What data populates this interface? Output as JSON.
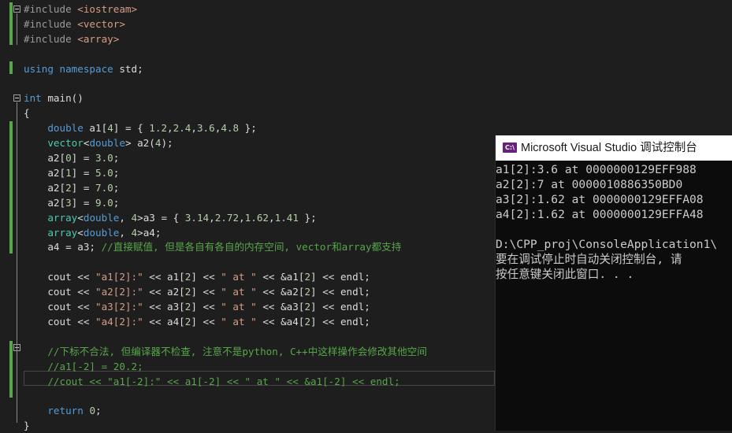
{
  "editor": {
    "lines": [
      [
        [
          "pp",
          "#include "
        ],
        [
          "inc",
          "<iostream>"
        ]
      ],
      [
        [
          "pp",
          "#include "
        ],
        [
          "inc",
          "<vector>"
        ]
      ],
      [
        [
          "pp",
          "#include "
        ],
        [
          "inc",
          "<array>"
        ]
      ],
      [],
      [
        [
          "kw",
          "using namespace"
        ],
        [
          "plain",
          " std;"
        ]
      ],
      [],
      [
        [
          "kw",
          "int"
        ],
        [
          "plain",
          " main()"
        ]
      ],
      [
        [
          "plain",
          "{"
        ]
      ],
      [
        [
          "plain",
          "    "
        ],
        [
          "kw",
          "double"
        ],
        [
          "plain",
          " a1["
        ],
        [
          "num",
          "4"
        ],
        [
          "plain",
          "] = { "
        ],
        [
          "num",
          "1.2"
        ],
        [
          "plain",
          ","
        ],
        [
          "num",
          "2.4"
        ],
        [
          "plain",
          ","
        ],
        [
          "num",
          "3.6"
        ],
        [
          "plain",
          ","
        ],
        [
          "num",
          "4.8"
        ],
        [
          "plain",
          " };"
        ]
      ],
      [
        [
          "plain",
          "    "
        ],
        [
          "ty",
          "vector"
        ],
        [
          "plain",
          "<"
        ],
        [
          "kw",
          "double"
        ],
        [
          "plain",
          "> a2("
        ],
        [
          "num",
          "4"
        ],
        [
          "plain",
          ");"
        ]
      ],
      [
        [
          "plain",
          "    a2["
        ],
        [
          "num",
          "0"
        ],
        [
          "plain",
          "] = "
        ],
        [
          "num",
          "3.0"
        ],
        [
          "plain",
          ";"
        ]
      ],
      [
        [
          "plain",
          "    a2["
        ],
        [
          "num",
          "1"
        ],
        [
          "plain",
          "] = "
        ],
        [
          "num",
          "5.0"
        ],
        [
          "plain",
          ";"
        ]
      ],
      [
        [
          "plain",
          "    a2["
        ],
        [
          "num",
          "2"
        ],
        [
          "plain",
          "] = "
        ],
        [
          "num",
          "7.0"
        ],
        [
          "plain",
          ";"
        ]
      ],
      [
        [
          "plain",
          "    a2["
        ],
        [
          "num",
          "3"
        ],
        [
          "plain",
          "] = "
        ],
        [
          "num",
          "9.0"
        ],
        [
          "plain",
          ";"
        ]
      ],
      [
        [
          "plain",
          "    "
        ],
        [
          "ty",
          "array"
        ],
        [
          "plain",
          "<"
        ],
        [
          "kw",
          "double"
        ],
        [
          "plain",
          ", "
        ],
        [
          "num",
          "4"
        ],
        [
          "plain",
          ">a3 = { "
        ],
        [
          "num",
          "3.14"
        ],
        [
          "plain",
          ","
        ],
        [
          "num",
          "2.72"
        ],
        [
          "plain",
          ","
        ],
        [
          "num",
          "1.62"
        ],
        [
          "plain",
          ","
        ],
        [
          "num",
          "1.41"
        ],
        [
          "plain",
          " };"
        ]
      ],
      [
        [
          "plain",
          "    "
        ],
        [
          "ty",
          "array"
        ],
        [
          "plain",
          "<"
        ],
        [
          "kw",
          "double"
        ],
        [
          "plain",
          ", "
        ],
        [
          "num",
          "4"
        ],
        [
          "plain",
          ">a4;"
        ]
      ],
      [
        [
          "plain",
          "    a4 = a3; "
        ],
        [
          "cm",
          "//直接赋值, 但是各自有各自的内存空间, vector和array都支持"
        ]
      ],
      [],
      [
        [
          "plain",
          "    cout << "
        ],
        [
          "str",
          "\"a1[2]:\""
        ],
        [
          "plain",
          " << a1["
        ],
        [
          "num",
          "2"
        ],
        [
          "plain",
          "] << "
        ],
        [
          "str",
          "\" at \""
        ],
        [
          "plain",
          " << &a1["
        ],
        [
          "num",
          "2"
        ],
        [
          "plain",
          "] << endl;"
        ]
      ],
      [
        [
          "plain",
          "    cout << "
        ],
        [
          "str",
          "\"a2[2]:\""
        ],
        [
          "plain",
          " << a2["
        ],
        [
          "num",
          "2"
        ],
        [
          "plain",
          "] << "
        ],
        [
          "str",
          "\" at \""
        ],
        [
          "plain",
          " << &a2["
        ],
        [
          "num",
          "2"
        ],
        [
          "plain",
          "] << endl;"
        ]
      ],
      [
        [
          "plain",
          "    cout << "
        ],
        [
          "str",
          "\"a3[2]:\""
        ],
        [
          "plain",
          " << a3["
        ],
        [
          "num",
          "2"
        ],
        [
          "plain",
          "] << "
        ],
        [
          "str",
          "\" at \""
        ],
        [
          "plain",
          " << &a3["
        ],
        [
          "num",
          "2"
        ],
        [
          "plain",
          "] << endl;"
        ]
      ],
      [
        [
          "plain",
          "    cout << "
        ],
        [
          "str",
          "\"a4[2]:\""
        ],
        [
          "plain",
          " << a4["
        ],
        [
          "num",
          "2"
        ],
        [
          "plain",
          "] << "
        ],
        [
          "str",
          "\" at \""
        ],
        [
          "plain",
          " << &a4["
        ],
        [
          "num",
          "2"
        ],
        [
          "plain",
          "] << endl;"
        ]
      ],
      [],
      [
        [
          "cm",
          "    //下标不合法, 但编译器不检查, 注意不是python, C++中这样操作会修改其他空间"
        ]
      ],
      [
        [
          "cm",
          "    //a1[-2] = 20.2;"
        ]
      ],
      [
        [
          "cm",
          "    //cout << \"a1[-2]:\" << a1[-2] << \" at \" << &a1[-2] << endl;"
        ]
      ],
      [],
      [
        [
          "plain",
          "    "
        ],
        [
          "kw",
          "return"
        ],
        [
          "plain",
          " "
        ],
        [
          "num",
          "0"
        ],
        [
          "plain",
          ";"
        ]
      ],
      [
        [
          "plain",
          "}"
        ]
      ]
    ]
  },
  "console": {
    "title": "Microsoft Visual Studio 调试控制台",
    "icon_label": "C:\\",
    "icon_color": "#68217a",
    "lines": [
      "a1[2]:3.6 at 0000000129EFF988",
      "a2[2]:7 at 0000010886350BD0",
      "a3[2]:1.62 at 0000000129EFFA08",
      "a4[2]:1.62 at 0000000129EFFA48",
      "",
      "D:\\CPP_proj\\ConsoleApplication1\\",
      "要在调试停止时自动关闭控制台, 请",
      "按任意键关闭此窗口. . ."
    ]
  },
  "colors": {
    "background": "#1e1e1e",
    "keyword": "#569cd6",
    "type": "#4ec9b0",
    "string": "#d69d85",
    "number": "#b5cea8",
    "comment": "#57a64a",
    "change_bar": "#57a64a"
  }
}
